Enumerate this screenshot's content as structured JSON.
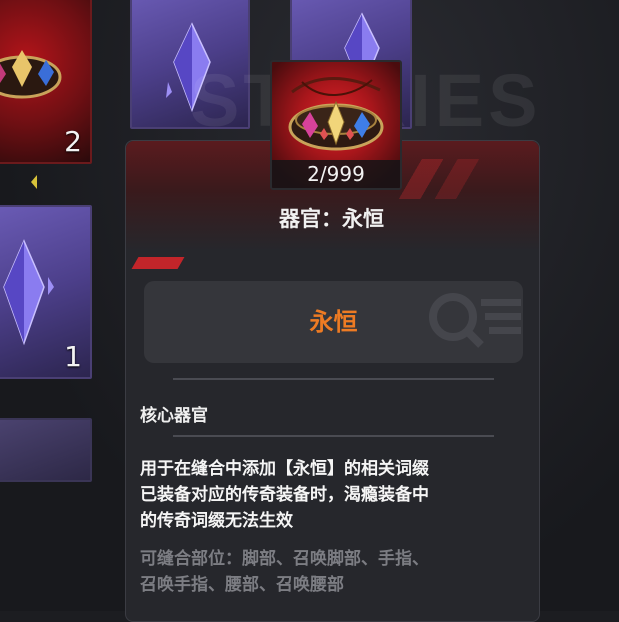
{
  "background": {
    "watermark": "STORIES",
    "cards": [
      {
        "type": "red",
        "count": "2"
      },
      {
        "type": "purple",
        "count": ""
      },
      {
        "type": "purple",
        "count": ""
      },
      {
        "type": "purple",
        "count": "1"
      },
      {
        "type": "dim",
        "count": ""
      }
    ]
  },
  "item": {
    "quantity": "2/999",
    "title": "器官：永恒",
    "name": "永恒",
    "name_color": "#ee7b23",
    "category": "核心器官",
    "description_lines": [
      "用于在缝合中添加【永恒】的相关词缀",
      "已装备对应的传奇装备时，渴瘾装备中",
      "的传奇词缀无法生效"
    ],
    "slots_lines": [
      "可缝合部位：脚部、召唤脚部、手指、",
      "召唤手指、腰部、召唤腰部"
    ]
  },
  "icons": {
    "item": "organ-crown-icon",
    "crystal": "crystal-icon",
    "search_deco": "magnifier-icon"
  }
}
